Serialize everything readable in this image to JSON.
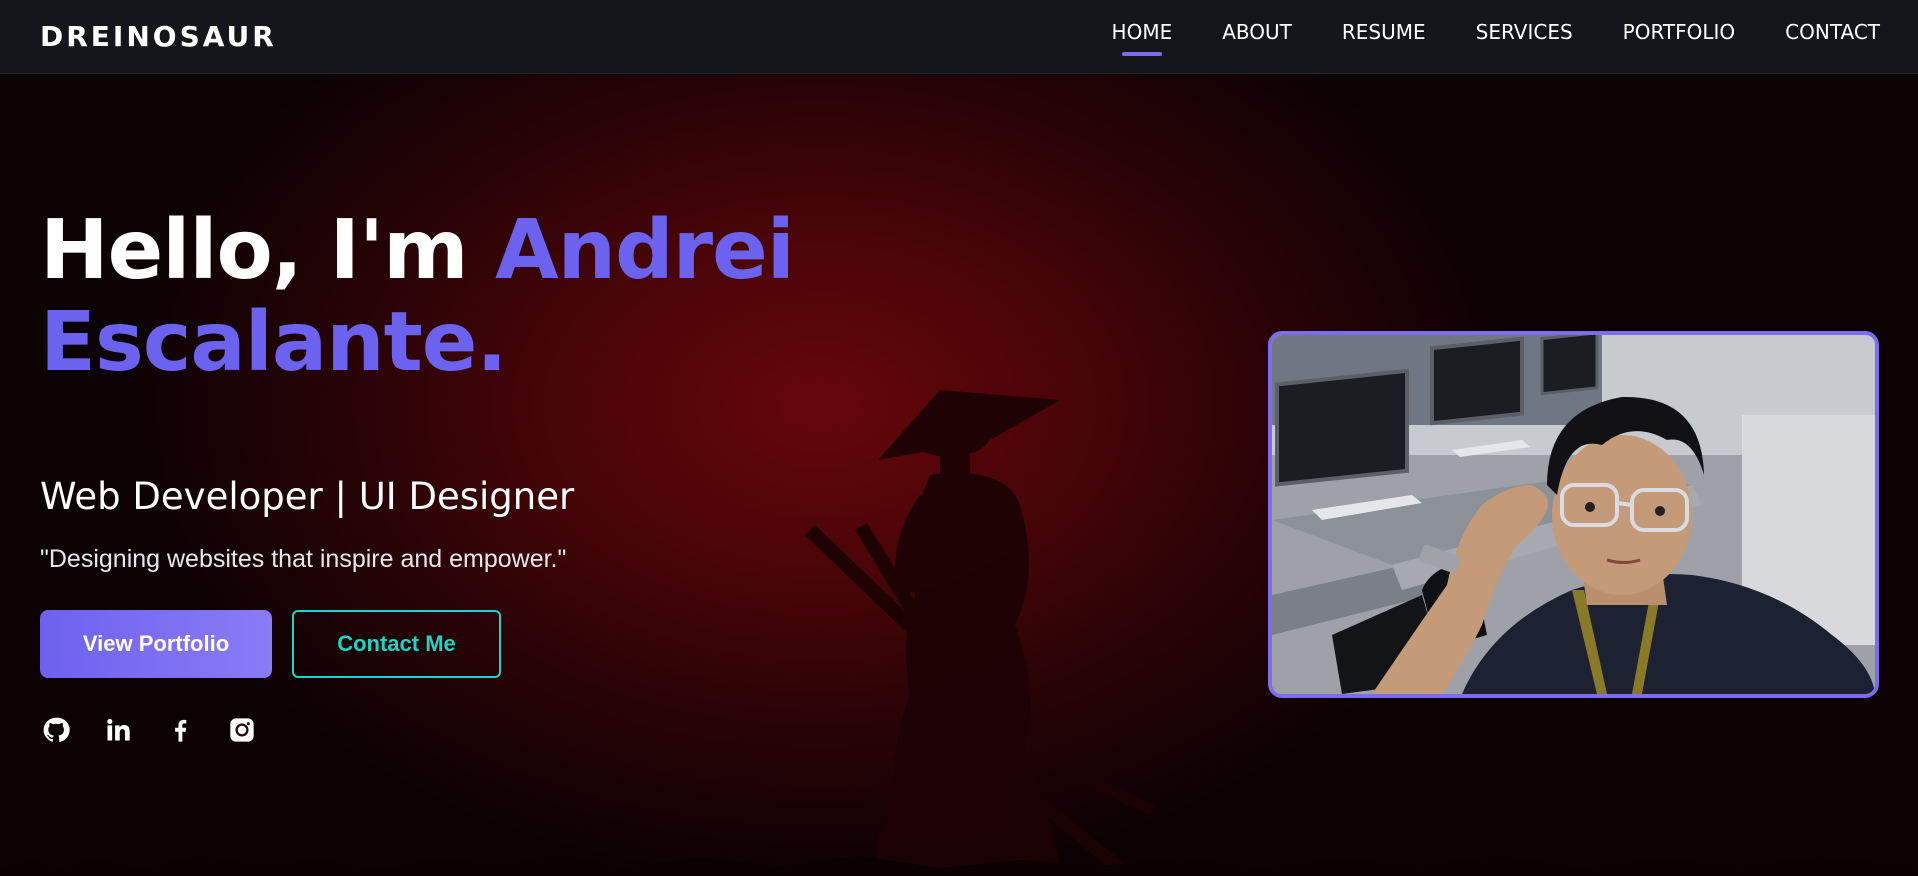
{
  "brand": "DREINOSAUR",
  "nav": {
    "items": [
      {
        "label": "HOME",
        "active": true
      },
      {
        "label": "ABOUT",
        "active": false
      },
      {
        "label": "RESUME",
        "active": false
      },
      {
        "label": "SERVICES",
        "active": false
      },
      {
        "label": "PORTFOLIO",
        "active": false
      },
      {
        "label": "CONTACT",
        "active": false
      }
    ]
  },
  "hero": {
    "greeting": "Hello, I'm ",
    "name_first": "Andrei",
    "name_last": "Escalante.",
    "subtitle": "Web Developer | UI Designer",
    "quote": "\"Designing websites that inspire and empower.\"",
    "primary_button": "View Portfolio",
    "secondary_button": "Contact Me"
  },
  "socials": [
    {
      "icon": "github-icon"
    },
    {
      "icon": "linkedin-icon"
    },
    {
      "icon": "facebook-icon"
    },
    {
      "icon": "instagram-icon"
    }
  ],
  "colors": {
    "accent": "#6b63f0",
    "teal": "#19d6c8",
    "navbar_bg": "#15161b",
    "hero_red": "#650609"
  }
}
